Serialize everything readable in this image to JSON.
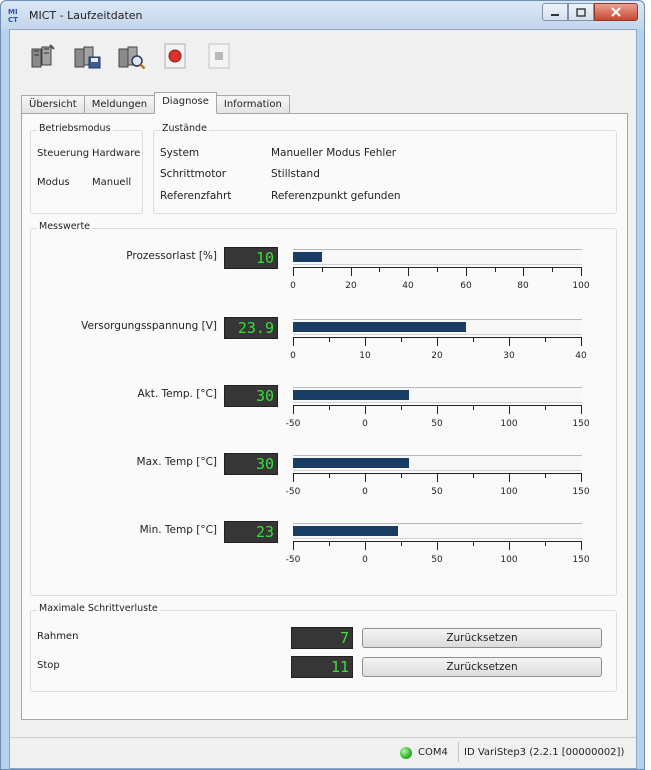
{
  "window": {
    "title": "MICT - Laufzeitdaten",
    "app_icon_text": "MI CT"
  },
  "toolbar": {
    "buttons": [
      {
        "icon": "device-connect-icon"
      },
      {
        "icon": "device-save-icon"
      },
      {
        "icon": "device-search-icon"
      },
      {
        "icon": "record-icon"
      },
      {
        "icon": "stop-icon"
      }
    ]
  },
  "tabs": [
    {
      "label": "Übersicht",
      "active": false
    },
    {
      "label": "Meldungen",
      "active": false
    },
    {
      "label": "Diagnose",
      "active": true
    },
    {
      "label": "Information",
      "active": false
    }
  ],
  "betriebsmodus": {
    "title": "Betriebsmodus",
    "rows": [
      {
        "label": "Steuerung",
        "value": "Hardware"
      },
      {
        "label": "Modus",
        "value": "Manuell"
      }
    ]
  },
  "zustaende": {
    "title": "Zustände",
    "rows": [
      {
        "label": "System",
        "value": "Manueller Modus Fehler"
      },
      {
        "label": "Schrittmotor",
        "value": "Stillstand"
      },
      {
        "label": "Referenzfahrt",
        "value": "Referenzpunkt gefunden"
      }
    ]
  },
  "messwerte": {
    "title": "Messwerte",
    "meters": [
      {
        "label": "Prozessorlast [%]",
        "display": "10",
        "value": 10,
        "min": 0,
        "max": 100,
        "ticks": [
          "0",
          "20",
          "40",
          "60",
          "80",
          "100"
        ],
        "minor_per_major": 1
      },
      {
        "label": "Versorgungsspannung [V]",
        "display": "23.9",
        "value": 23.9,
        "min": 0,
        "max": 40,
        "ticks": [
          "0",
          "10",
          "20",
          "30",
          "40"
        ],
        "minor_per_major": 1
      },
      {
        "label": "Akt. Temp. [°C]",
        "display": "30",
        "value": 30,
        "min": -50,
        "max": 150,
        "ticks": [
          "-50",
          "0",
          "50",
          "100",
          "150"
        ],
        "minor_per_major": 1
      },
      {
        "label": "Max. Temp [°C]",
        "display": "30",
        "value": 30,
        "min": -50,
        "max": 150,
        "ticks": [
          "-50",
          "0",
          "50",
          "100",
          "150"
        ],
        "minor_per_major": 1
      },
      {
        "label": "Min. Temp [°C]",
        "display": "23",
        "value": 23,
        "min": -50,
        "max": 150,
        "ticks": [
          "-50",
          "0",
          "50",
          "100",
          "150"
        ],
        "minor_per_major": 1
      }
    ]
  },
  "schrittverluste": {
    "title": "Maximale Schrittverluste",
    "rows": [
      {
        "label": "Rahmen",
        "display": "7",
        "button": "Zurücksetzen"
      },
      {
        "label": "Stop",
        "display": "11",
        "button": "Zurücksetzen"
      }
    ]
  },
  "statusbar": {
    "led_color": "#2fb52f",
    "port": "COM4",
    "device": "ID VariStep3 (2.2.1 [00000002])"
  },
  "colors": {
    "bar_fill": "#183c64",
    "lcd_background": "#363636",
    "lcd_digits": "#37e037"
  }
}
